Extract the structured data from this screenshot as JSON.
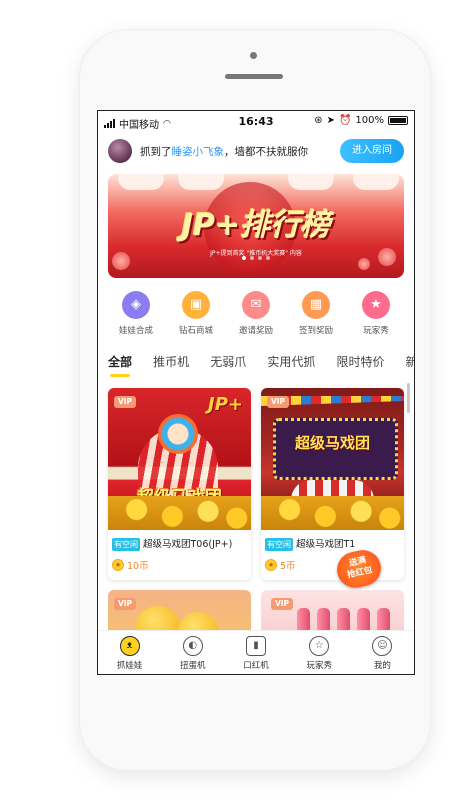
{
  "status_bar": {
    "carrier": "中国移动",
    "time": "16:43",
    "battery": "100%"
  },
  "notice": {
    "prefix": "抓到了",
    "username": "睡姿小飞象",
    "suffix": "，墙都不扶就服你",
    "button_label": "进入房间"
  },
  "banner": {
    "title": "JP+排行榜",
    "subtitle": "JP+提到首奖 \"推币机大奖赛\" 内容",
    "dot_count": 4
  },
  "menu": [
    {
      "label": "娃娃合成",
      "icon": "cube-icon",
      "color": "#8c7cf2"
    },
    {
      "label": "钻石商城",
      "icon": "shop-icon",
      "color": "#ffb13b"
    },
    {
      "label": "邀请奖励",
      "icon": "mail-icon",
      "color": "#ff8a8a"
    },
    {
      "label": "签到奖励",
      "icon": "calendar-icon",
      "color": "#ff9a54"
    },
    {
      "label": "玩家秀",
      "icon": "star-icon",
      "color": "#ff6a8f"
    }
  ],
  "tabs": [
    "全部",
    "推币机",
    "无弱爪",
    "实用代抓",
    "限时特价",
    "新"
  ],
  "active_tab": "全部",
  "cards": [
    {
      "vip": "VIP",
      "badge": "有空闲",
      "title": "超级马戏团T06(JP+)",
      "price": "10币",
      "image_text": "超级马戏团",
      "mark": "JP+"
    },
    {
      "vip": "VIP",
      "badge": "有空闲",
      "title": "超级马戏团T1",
      "price": "5币",
      "image_text": "超级马戏团"
    }
  ],
  "redpacket": "送满\n抢红包",
  "bottom_cards": [
    {
      "vip": "VIP"
    },
    {
      "vip": "VIP"
    }
  ],
  "tabbar": [
    {
      "label": "抓娃娃",
      "icon": "bear-icon",
      "active": true
    },
    {
      "label": "扭蛋机",
      "icon": "capsule-icon",
      "active": false
    },
    {
      "label": "口红机",
      "icon": "lipstick-icon",
      "active": false
    },
    {
      "label": "玩家秀",
      "icon": "star-icon",
      "active": false
    },
    {
      "label": "我的",
      "icon": "profile-icon",
      "active": false
    }
  ]
}
